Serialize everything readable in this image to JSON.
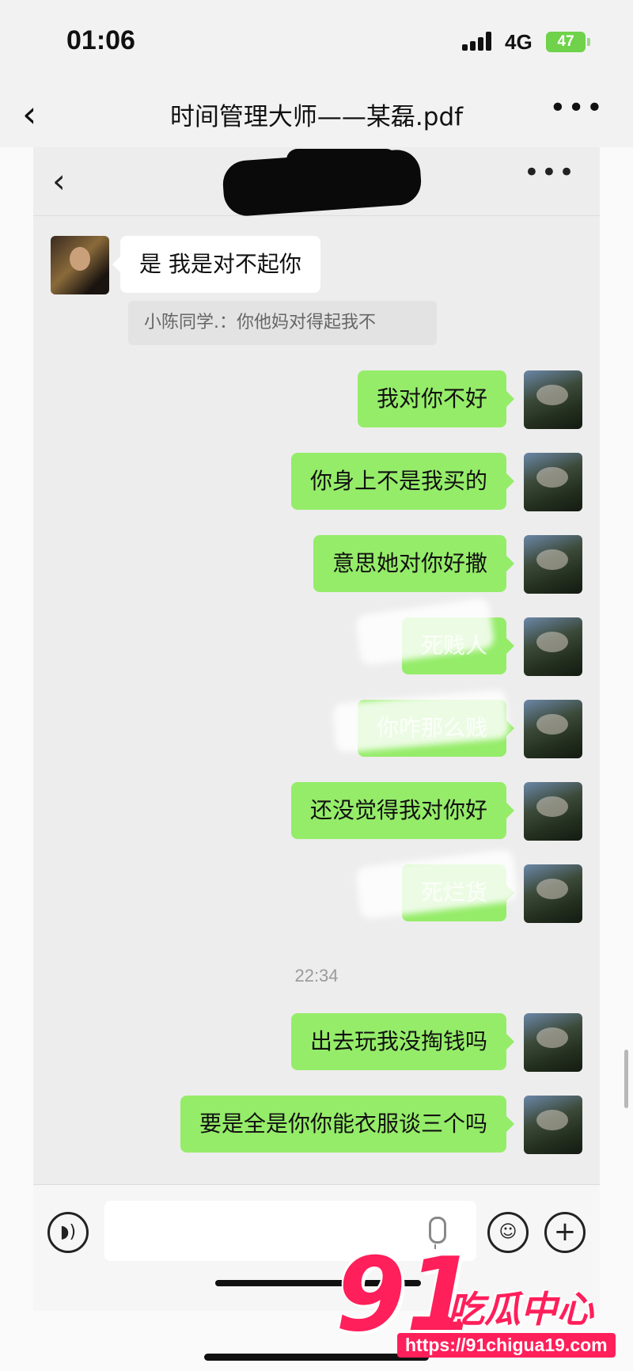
{
  "status": {
    "time": "01:06",
    "network": "4G",
    "battery": "47"
  },
  "outer_nav": {
    "title": "时间管理大师——某磊.pdf"
  },
  "chat": {
    "incoming": {
      "text": "是  我是对不起你",
      "quote": "小陈同学.：你他妈对得起我不"
    },
    "outgoing": [
      {
        "text": "我对你不好"
      },
      {
        "text": "你身上不是我买的"
      },
      {
        "text": "意思她对你好撒"
      },
      {
        "text": "死贱人"
      },
      {
        "text": "你咋那么贱"
      },
      {
        "text": "还没觉得我对你好"
      },
      {
        "text": "死烂货"
      }
    ],
    "timestamp": "22:34",
    "outgoing_after": [
      {
        "text": "出去玩我没掏钱吗"
      },
      {
        "text": "要是全是你你能衣服谈三个吗"
      }
    ]
  },
  "input_bar": {
    "value": ""
  },
  "watermark": {
    "number": "91",
    "brand": "吃瓜中心",
    "url": "https://91chigua19.com"
  },
  "colors": {
    "bubble_out": "#95ec69",
    "bubble_in": "#ffffff",
    "watermark": "#ff1f5a",
    "battery": "#6fd24a"
  },
  "icons": [
    "back-icon",
    "more-icon",
    "voice-icon",
    "mic-icon",
    "emoji-icon",
    "plus-icon"
  ]
}
